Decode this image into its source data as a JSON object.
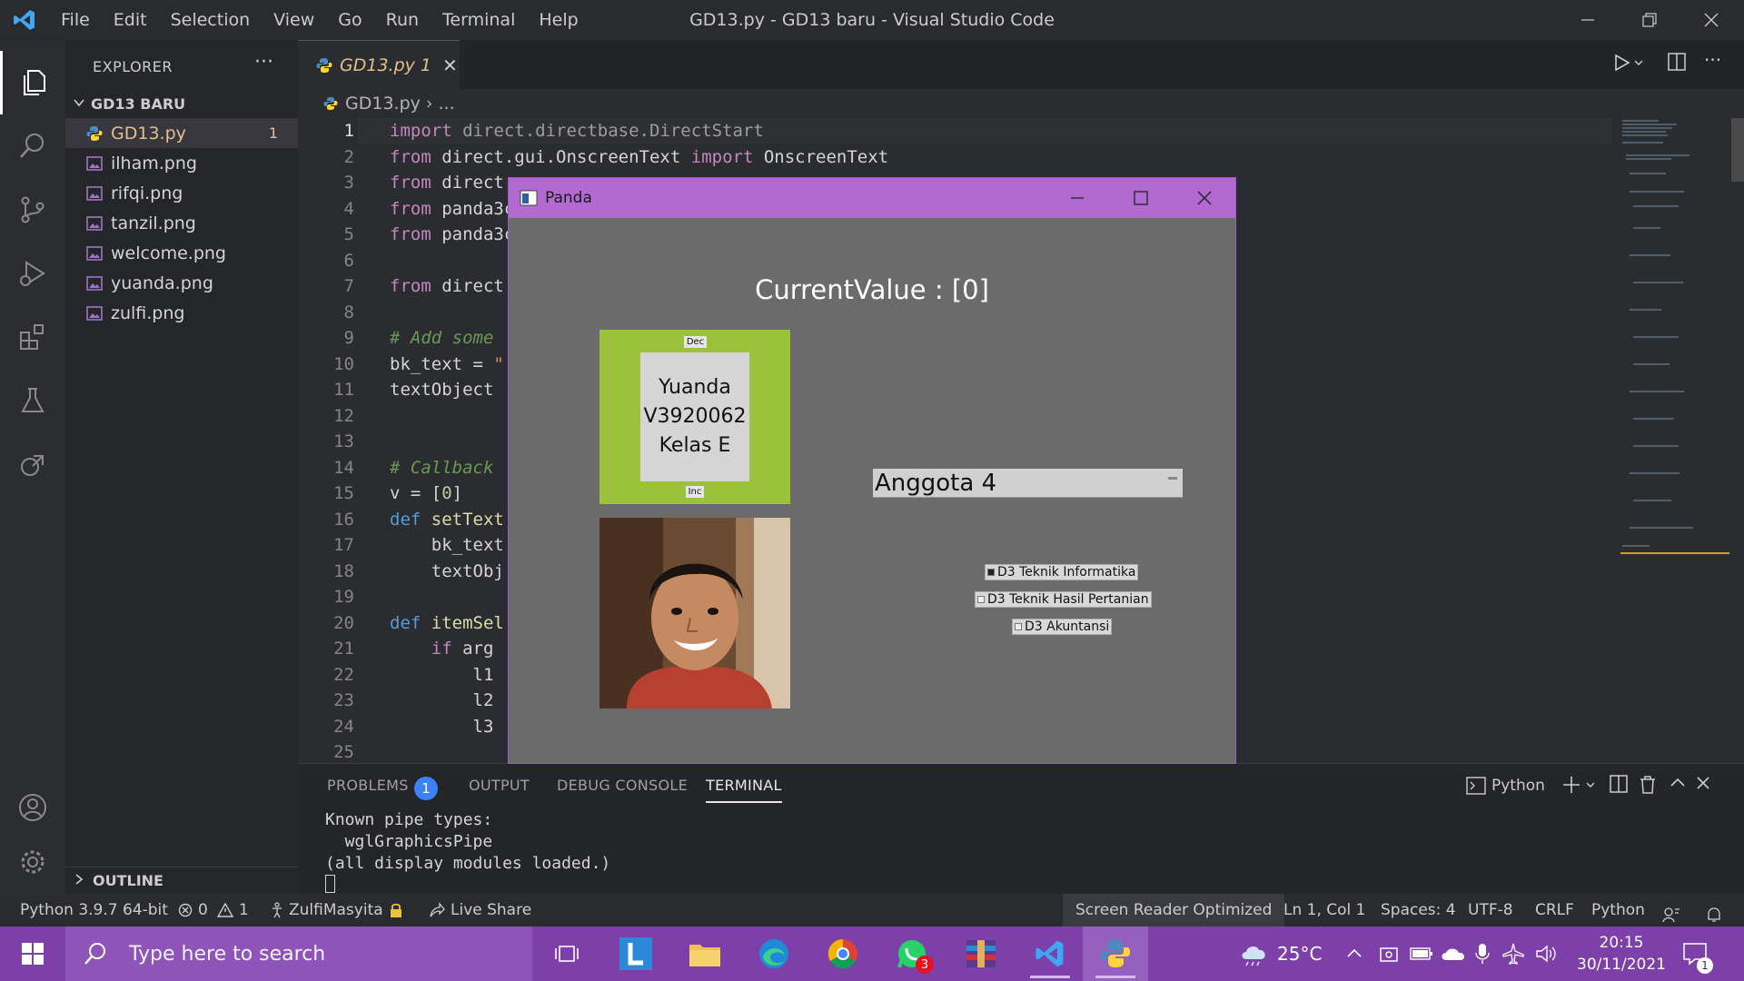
{
  "window": {
    "title": "GD13.py - GD13 baru - Visual Studio Code",
    "menu": [
      "File",
      "Edit",
      "Selection",
      "View",
      "Go",
      "Run",
      "Terminal",
      "Help"
    ]
  },
  "explorer": {
    "title": "EXPLORER",
    "more": "···",
    "folder": "GD13 BARU",
    "files": [
      {
        "name": "GD13.py",
        "badge": "1"
      },
      {
        "name": "ilham.png"
      },
      {
        "name": "rifqi.png"
      },
      {
        "name": "tanzil.png"
      },
      {
        "name": "welcome.png"
      },
      {
        "name": "yuanda.png"
      },
      {
        "name": "zulfi.png"
      }
    ],
    "outline": "OUTLINE"
  },
  "editor": {
    "tab": {
      "label": "GD13.py 1",
      "close": "✕"
    },
    "breadcrumb": {
      "file": "GD13.py",
      "sep": "›",
      "rest": "..."
    },
    "line_numbers": [
      "1",
      "2",
      "3",
      "4",
      "5",
      "6",
      "7",
      "8",
      "9",
      "10",
      "11",
      "12",
      "13",
      "14",
      "15",
      "16",
      "17",
      "18",
      "19",
      "20",
      "21",
      "22",
      "23",
      "24",
      "25"
    ]
  },
  "panel": {
    "tabs": {
      "problems": "PROBLEMS",
      "output": "OUTPUT",
      "debug": "DEBUG CONSOLE",
      "terminal": "TERMINAL"
    },
    "problems_count": "1",
    "terminal_shell": "Python",
    "terminal_lines": "Known pipe types:\n  wglGraphicsPipe\n(all display modules loaded.)"
  },
  "statusbar": {
    "interpreter": "Python 3.9.7 64-bit",
    "errors": "0",
    "warnings": "1",
    "account": "ZulfiMasyita",
    "live_share": "Live Share",
    "screen_reader": "Screen Reader Optimized",
    "position": "Ln 1, Col 1",
    "spaces": "Spaces: 4",
    "encoding": "UTF-8",
    "eol": "CRLF",
    "language": "Python"
  },
  "taskbar": {
    "search_placeholder": "Type here to search",
    "whatsapp_badge": "3",
    "weather": "25°C",
    "time": "20:15",
    "date": "30/11/2021",
    "notifications": "1"
  },
  "panda_window": {
    "title": "Panda",
    "current_value": "CurrentValue : [0]",
    "dec_label": "Dec",
    "inc_label": "Inc",
    "card_lines": [
      "Yuanda",
      "V3920062",
      "Kelas E"
    ],
    "dropdown_value": "Anggota 4",
    "radio_options": [
      {
        "label": "D3 Teknik Informatika",
        "selected": true
      },
      {
        "label": "D3 Teknik Hasil Pertanian",
        "selected": false
      },
      {
        "label": "D3 Akuntansi",
        "selected": false
      }
    ]
  },
  "colors": {
    "panda_titlebar": "#b36ad0",
    "taskbar": "#7d3fa8",
    "green_frame": "#9cc13a",
    "modified_file": "#e2c08d"
  }
}
